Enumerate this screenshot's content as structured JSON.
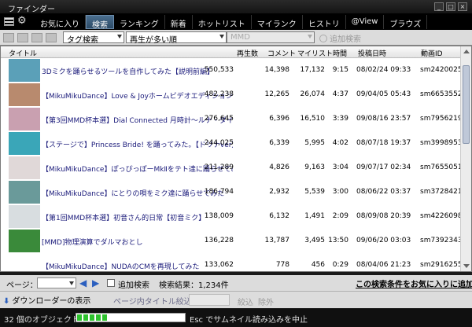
{
  "window": {
    "title": "ファインダー"
  },
  "tabs": [
    "お気に入り",
    "検索",
    "ランキング",
    "新着",
    "ホットリスト",
    "マイランク",
    "ヒストリ",
    "@View",
    "ブラウズ"
  ],
  "active_tab": 1,
  "search": {
    "mode": "タグ検索",
    "sort": "再生が多い順",
    "keyword": "MMD",
    "add_search": "追加検索"
  },
  "columns": {
    "title": "タイトル",
    "views": "再生数",
    "comments": "コメント",
    "mylist": "マイリスト",
    "length": "時間",
    "posted": "投稿日時",
    "video_id": "動画ID"
  },
  "rows": [
    {
      "title": "3Dミクを踊らせるツールを自作してみた【説明前編】",
      "views": "550,533",
      "comments": "14,398",
      "mylist": "17,132",
      "length": "9:15",
      "posted": "08/02/24 09:33",
      "video_id": "sm2420025",
      "thumb": "#5ba0b8"
    },
    {
      "title": "【MikuMikuDance】Love & Joyホームビデオエディション修正版【M...",
      "views": "482,238",
      "comments": "12,265",
      "mylist": "26,074",
      "length": "4:37",
      "posted": "09/04/05 05:43",
      "video_id": "sm6653552",
      "thumb": "#b88a6e"
    },
    {
      "title": "【第3回MMD杯本選】Dial Connected 月時計～ルナ・ダイアル...",
      "views": "276,645",
      "comments": "6,396",
      "mylist": "16,510",
      "length": "3:39",
      "posted": "09/08/16 23:57",
      "video_id": "sm7956219",
      "thumb": "#c9a0b0"
    },
    {
      "title": "【ステージで】Princess Bride! を踊ってみた。【ドリナver】",
      "views": "244,025",
      "comments": "6,339",
      "mylist": "5,995",
      "length": "4:02",
      "posted": "08/07/18 19:37",
      "video_id": "sm3998953",
      "thumb": "#3aa6b8"
    },
    {
      "title": "【MikuMikuDance】ぽっぴっぽーMkⅡをテト達に踊らせてみた",
      "views": "211,289",
      "comments": "4,826",
      "mylist": "9,163",
      "length": "3:04",
      "posted": "09/07/17 02:34",
      "video_id": "sm7655051",
      "thumb": "#e0d8d8"
    },
    {
      "title": "【MikuMikuDance】にとりの唄をミク達に踊らせてみた",
      "views": "186,794",
      "comments": "2,932",
      "mylist": "5,539",
      "length": "3:00",
      "posted": "08/06/22 03:37",
      "video_id": "sm3728421",
      "thumb": "#6a9a9a"
    },
    {
      "title": "【第1回MMD杯本選】初音さん的日常【初音ミク】",
      "views": "138,009",
      "comments": "6,132",
      "mylist": "1,491",
      "length": "2:09",
      "posted": "08/09/08 20:39",
      "video_id": "sm4226098",
      "thumb": "#d8dde0"
    },
    {
      "title": "[MMD]物理演算でダルマおとし",
      "views": "136,228",
      "comments": "13,787",
      "mylist": "3,495",
      "length": "13:50",
      "posted": "09/06/20 03:03",
      "video_id": "sm7392343",
      "thumb": "#3a8a3a"
    },
    {
      "title": "【MikuMikuDance】NUDAのCMを再現してみた",
      "views": "133,062",
      "comments": "778",
      "mylist": "456",
      "length": "0:29",
      "posted": "08/04/06 21:23",
      "video_id": "sm2916255",
      "thumb": "#ffffff"
    }
  ],
  "pager": {
    "page_label": "ページ：",
    "add_search_check": "追加検索",
    "result": "検索結果：1,234件",
    "favorite_link": "この検索条件をお気に入りに追加"
  },
  "bottom": {
    "downloader": "ダウンローダーの表示",
    "filter_label": "ページ内タイトル絞込",
    "narrow": "絞込",
    "exclude": "除外"
  },
  "status": {
    "objects": "32 個のオブジェクト",
    "progress": 0.29,
    "message": "Esc でサムネイル読み込みを中止"
  }
}
